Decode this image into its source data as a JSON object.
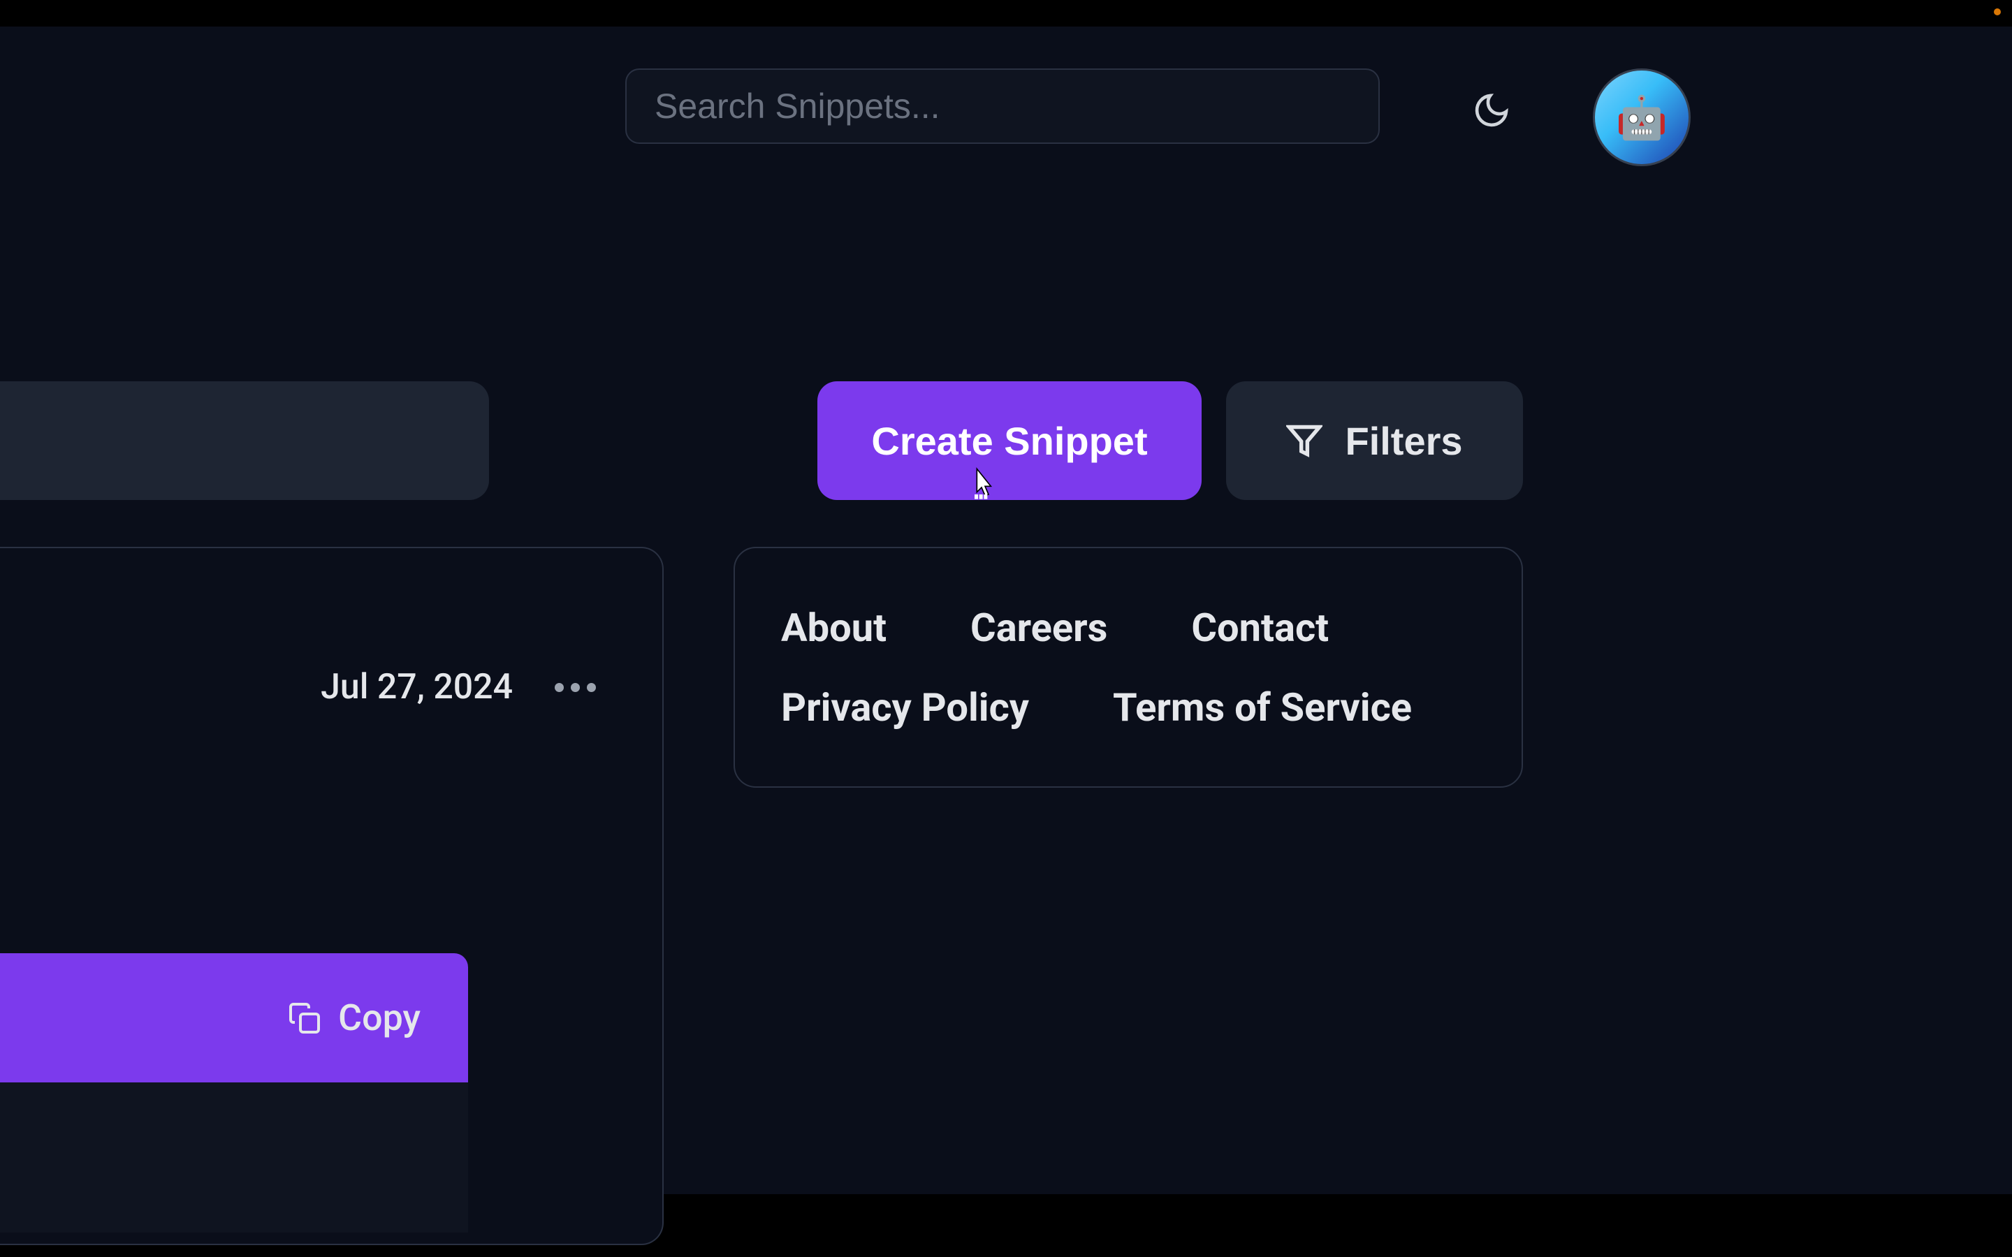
{
  "header": {
    "search_placeholder": "Search Snippets..."
  },
  "actions": {
    "create_label": "Create Snippet",
    "filters_label": "Filters",
    "copy_label": "Copy"
  },
  "footer": {
    "links": [
      "About",
      "Careers",
      "Contact",
      "Privacy Policy",
      "Terms of Service"
    ]
  },
  "snippet": {
    "date": "Jul 27, 2024"
  }
}
